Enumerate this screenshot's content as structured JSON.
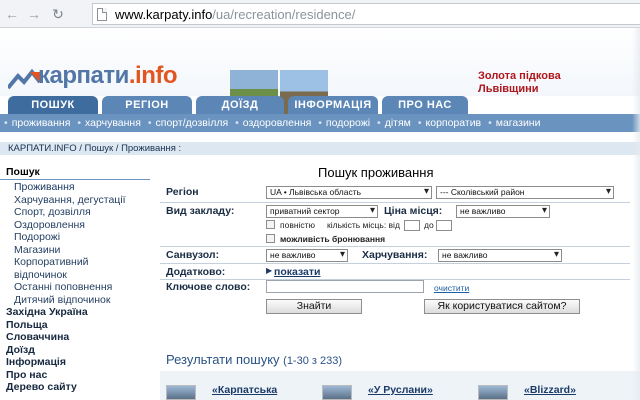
{
  "browser": {
    "url_domain": "www.karpaty.info",
    "url_path": "/ua/recreation/residence/"
  },
  "header": {
    "logo_text": "карпати",
    "logo_suffix": ".info",
    "tagline_line1": "Золота підкова",
    "tagline_line2": "Львівщини"
  },
  "tabs": [
    {
      "label": "ПОШУК"
    },
    {
      "label": "РЕГІОН"
    },
    {
      "label": "ДОЇЗД"
    },
    {
      "label": "ІНФОРМАЦІЯ"
    },
    {
      "label": "ПРО НАС"
    }
  ],
  "subnav": [
    "проживання",
    "харчування",
    "спорт/дозвілля",
    "оздоровлення",
    "подорожі",
    "дітям",
    "корпоратив",
    "магазини"
  ],
  "breadcrumb": "КАРПАТИ.INFO  /  Пошук  /  Проживання :",
  "sidebar": {
    "head": "Пошук",
    "sub_items": [
      "Проживання",
      "Харчування, дегустації",
      "Спорт, дозвілля",
      "Оздоровлення",
      "Подорожі",
      "Магазини",
      "Корпоративний відпочинок",
      "Останні поповнення",
      "Дитячий відпочинок"
    ],
    "sections": [
      "Західна Україна",
      "Польща",
      "Словаччина",
      "Доїзд",
      "Інформація",
      "Про нас",
      "Дерево сайту"
    ]
  },
  "form": {
    "title": "Пошук проживання",
    "region_label": "Регіон",
    "region_value": "UA • Львівська область",
    "district_value": "--- Сколівський район",
    "type_label": "Вид закладу:",
    "type_value": "приватний сектор",
    "price_label": "Ціна місця:",
    "price_value": "не важливо",
    "fully_label": "повністю",
    "places_label": "кількість місць: від",
    "to_label": "до",
    "booking_label": "можливість бронювання",
    "bathroom_label": "Санвузол:",
    "bathroom_value": "не важливо",
    "food_label": "Харчування:",
    "food_value": "не важливо",
    "extra_label": "Додатково:",
    "show_link": "показати",
    "keyword_label": "Ключове слово:",
    "clear_link": "очистити",
    "find_button": "Знайти",
    "howto_button": "Як користуватися сайтом?"
  },
  "results": {
    "title": "Результати пошуку",
    "count": "(1-30 з 233)",
    "items": [
      "«Карпатська",
      "«У Руслани»",
      "«Blizzard»"
    ]
  }
}
